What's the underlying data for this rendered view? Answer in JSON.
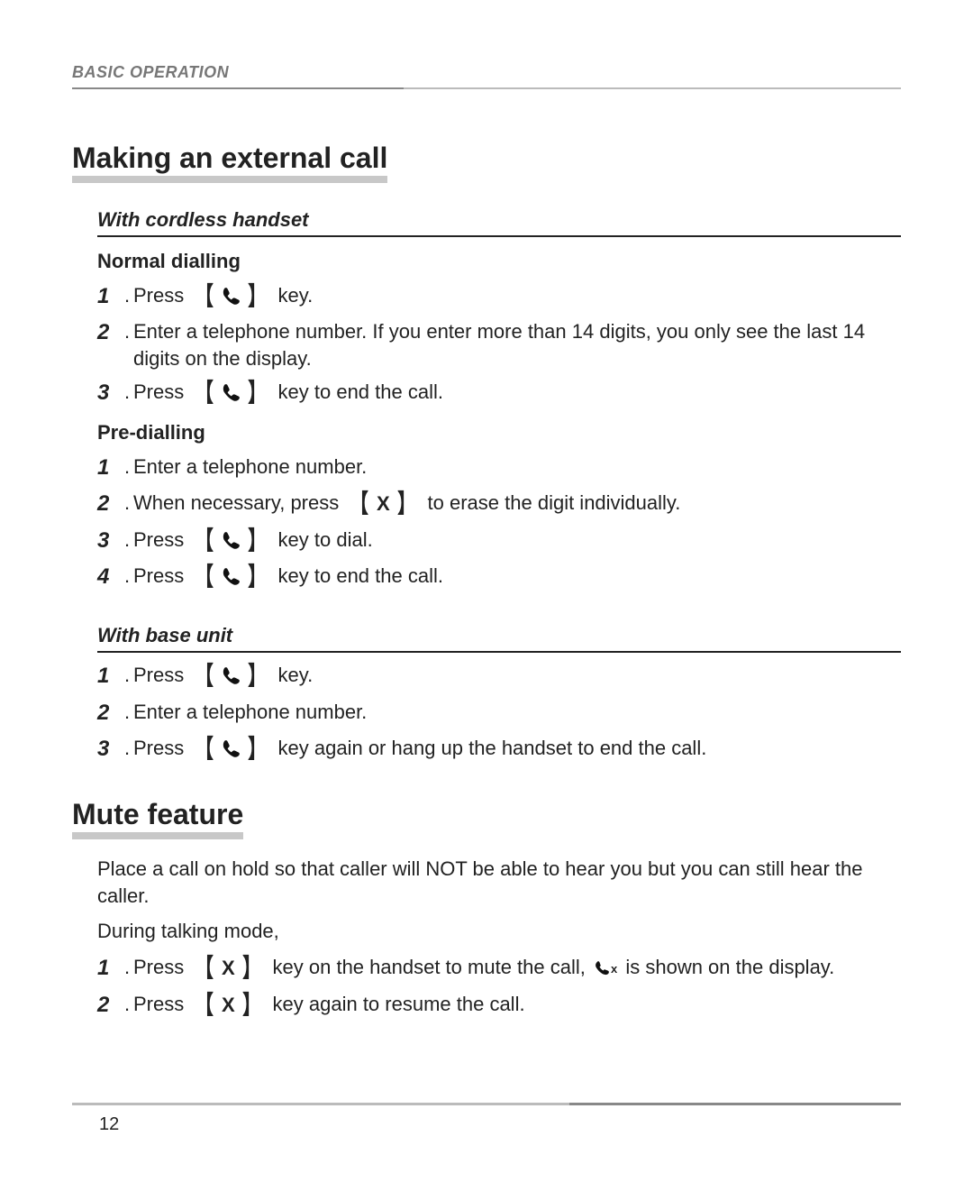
{
  "header": "BASIC OPERATION",
  "section1": {
    "title": "Making an external call",
    "sub1": {
      "title": "With cordless handset",
      "block1": {
        "title": "Normal dialling",
        "steps": {
          "s1_pre": "Press",
          "s1_post": "key.",
          "s2": "Enter a telephone number. If you enter more than 14 digits, you only see the last 14 digits on the display.",
          "s3_pre": "Press",
          "s3_post": "key to end the call."
        }
      },
      "block2": {
        "title": "Pre-dialling",
        "steps": {
          "s1": "Enter a telephone number.",
          "s2_pre": "When necessary, press",
          "s2_post": "to erase the digit individually.",
          "s3_pre": "Press",
          "s3_post": "key to dial.",
          "s4_pre": "Press",
          "s4_post": "key to end the call."
        }
      }
    },
    "sub2": {
      "title": "With base unit",
      "steps": {
        "s1_pre": "Press",
        "s1_post": "key.",
        "s2": "Enter a telephone number.",
        "s3_pre": "Press",
        "s3_post": "key again or hang up the handset to end the call."
      }
    }
  },
  "section2": {
    "title": "Mute feature",
    "para1": "Place a call on hold so that caller will NOT be able to hear you but you can still hear the caller.",
    "para2": "During talking mode,",
    "steps": {
      "s1_pre": "Press",
      "s1_mid": "key on the handset to mute the call,",
      "s1_post": "is shown on the display.",
      "s2_pre": "Press",
      "s2_post": "key again to resume the call."
    }
  },
  "page_number": "12"
}
